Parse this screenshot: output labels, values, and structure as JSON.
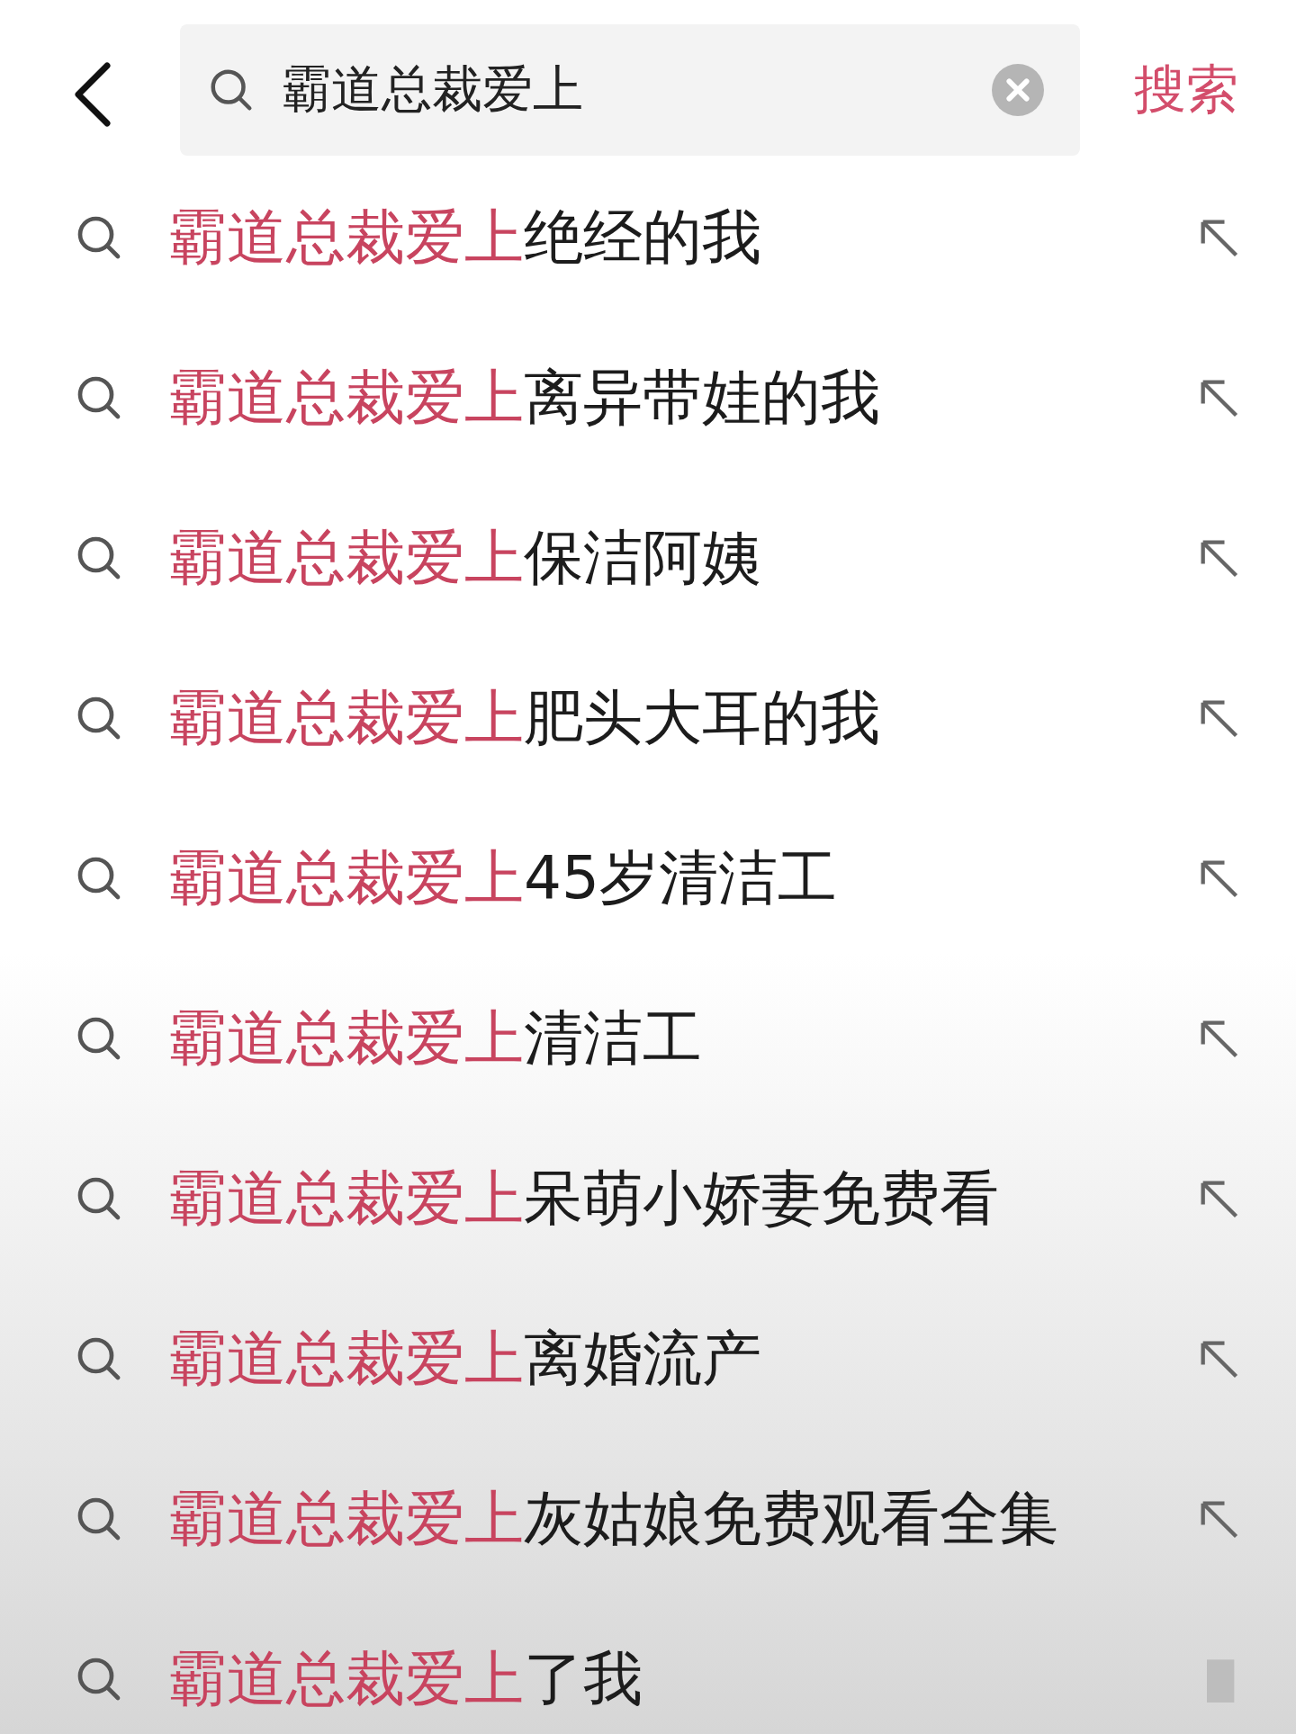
{
  "search_bar": {
    "value": "霸道总裁爱上",
    "submit": "搜索"
  },
  "suggestions": [
    {
      "match": "霸道总裁爱上",
      "rest": "绝经的我",
      "kind": "arrow"
    },
    {
      "match": "霸道总裁爱上",
      "rest": "离异带娃的我",
      "kind": "arrow"
    },
    {
      "match": "霸道总裁爱上",
      "rest": "保洁阿姨",
      "kind": "arrow"
    },
    {
      "match": "霸道总裁爱上",
      "rest": "肥头大耳的我",
      "kind": "arrow"
    },
    {
      "match": "霸道总裁爱上",
      "rest": "45岁清洁工",
      "kind": "arrow"
    },
    {
      "match": "霸道总裁爱上",
      "rest": "清洁工",
      "kind": "arrow"
    },
    {
      "match": "霸道总裁爱上",
      "rest": "呆萌小娇妻免费看",
      "kind": "arrow"
    },
    {
      "match": "霸道总裁爱上",
      "rest": "离婚流产",
      "kind": "arrow"
    },
    {
      "match": "霸道总裁爱上",
      "rest": "灰姑娘免费观看全集",
      "kind": "arrow"
    },
    {
      "match": "霸道总裁爱上",
      "rest": "了我",
      "kind": "block"
    }
  ]
}
